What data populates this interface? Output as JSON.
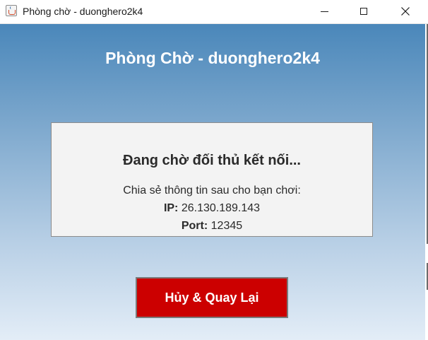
{
  "window": {
    "title": "Phòng chờ - duonghero2k4",
    "controls": {
      "minimize": "minimize",
      "maximize": "maximize",
      "close": "close"
    }
  },
  "room": {
    "heading": "Phòng Chờ - duonghero2k4",
    "status": "Đang chờ đối thủ kết nối...",
    "share_text": "Chia sẻ thông tin sau cho bạn chơi:",
    "ip_label": "IP:",
    "ip_value": "26.130.189.143",
    "port_label": "Port:",
    "port_value": "12345"
  },
  "actions": {
    "cancel_label": "Hủy & Quay Lại"
  },
  "colors": {
    "gradient_top": "#4a87ba",
    "gradient_bottom": "#e3edf7",
    "cancel_button": "#cc0000",
    "panel_bg": "#f3f3f3"
  },
  "icons": {
    "app": "java-cup-icon",
    "close": "close-icon"
  }
}
